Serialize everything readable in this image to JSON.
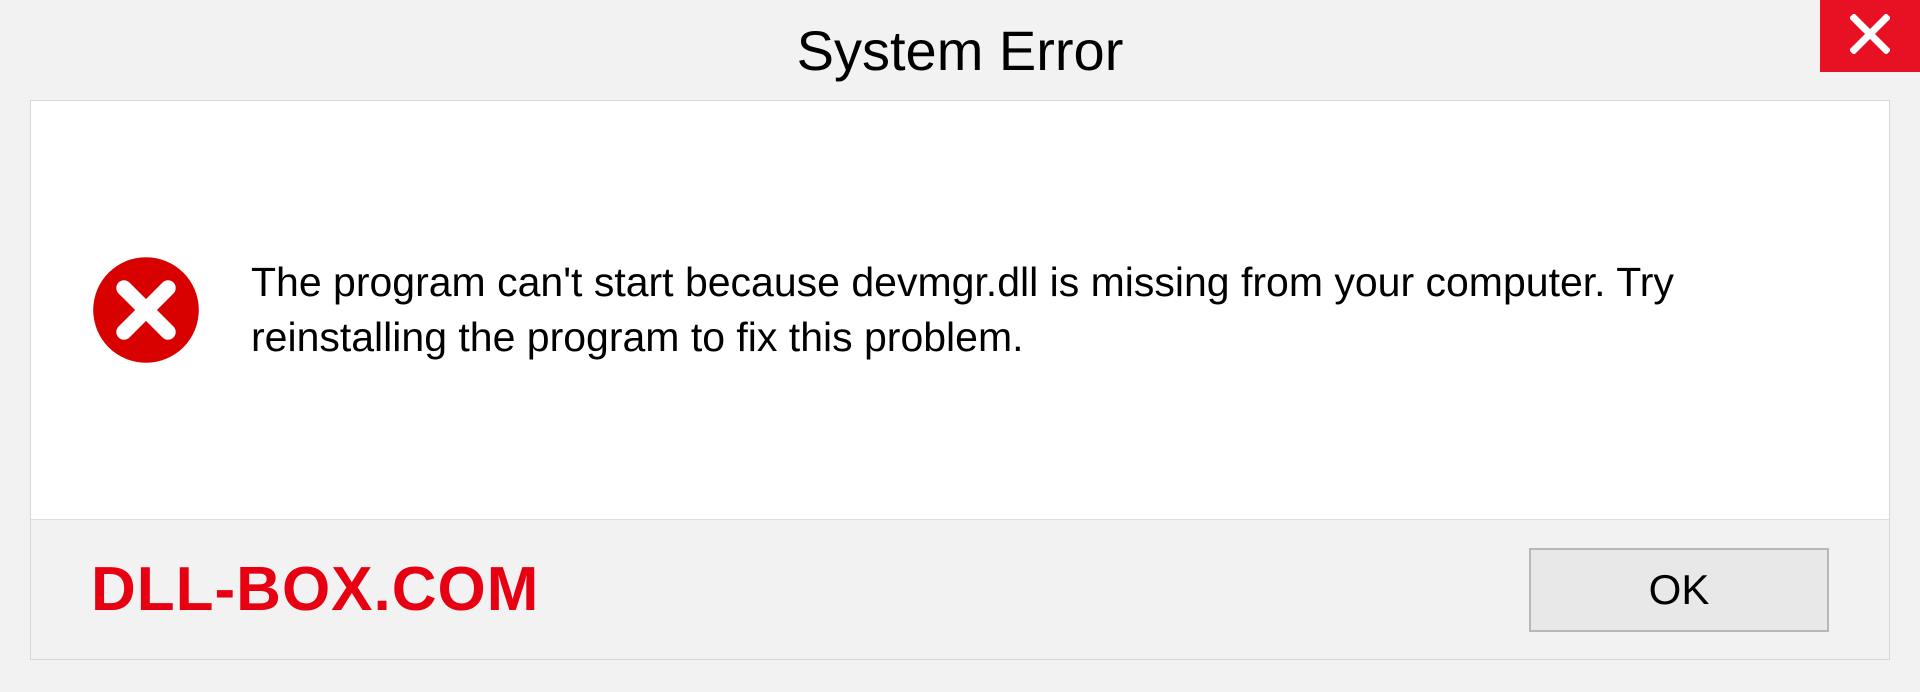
{
  "window": {
    "title": "System Error"
  },
  "message": {
    "text": "The program can't start because devmgr.dll is missing from your computer. Try reinstalling the program to fix this problem."
  },
  "footer": {
    "watermark": "DLL-BOX.COM",
    "ok_label": "OK"
  },
  "colors": {
    "close_bg": "#e81023",
    "error_icon": "#d90000",
    "watermark": "#e60012"
  }
}
